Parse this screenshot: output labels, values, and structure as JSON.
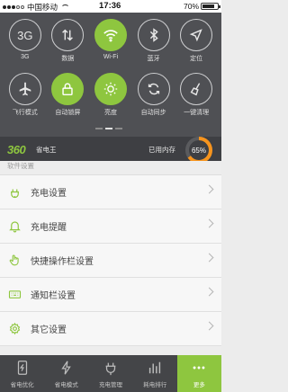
{
  "status_bar": {
    "carrier": "中国移动",
    "time": "17:36",
    "battery": "70%"
  },
  "quick_settings": {
    "row1": [
      {
        "label": "3G",
        "icon_text": "3G",
        "on": false
      },
      {
        "label": "数据",
        "on": false
      },
      {
        "label": "Wi-Fi",
        "on": true
      },
      {
        "label": "蓝牙",
        "on": false
      },
      {
        "label": "定位",
        "on": false
      }
    ],
    "row2": [
      {
        "label": "飞行模式",
        "on": false
      },
      {
        "label": "自动锁屏",
        "on": true
      },
      {
        "label": "亮度",
        "on": true
      },
      {
        "label": "自动同步",
        "on": false
      },
      {
        "label": "一键清理",
        "on": false
      }
    ]
  },
  "brand": {
    "logo": "360",
    "name": "省电王",
    "memory_label": "已用内存",
    "memory_percent_text": "65%",
    "memory_percent": 0.65
  },
  "settings": {
    "section_title": "软件设置",
    "items": [
      {
        "label": "充电设置"
      },
      {
        "label": "充电提醒"
      },
      {
        "label": "快捷操作栏设置"
      },
      {
        "label": "通知栏设置"
      },
      {
        "label": "其它设置"
      }
    ]
  },
  "tabs": [
    {
      "label": "省电优化"
    },
    {
      "label": "省电模式"
    },
    {
      "label": "充电管理"
    },
    {
      "label": "耗电排行"
    },
    {
      "label": "更多"
    }
  ],
  "colors": {
    "accent": "#8ec63f",
    "panel": "#4f5054",
    "gauge_track": "#5a5b5e",
    "gauge_fill": "#f7941d"
  }
}
